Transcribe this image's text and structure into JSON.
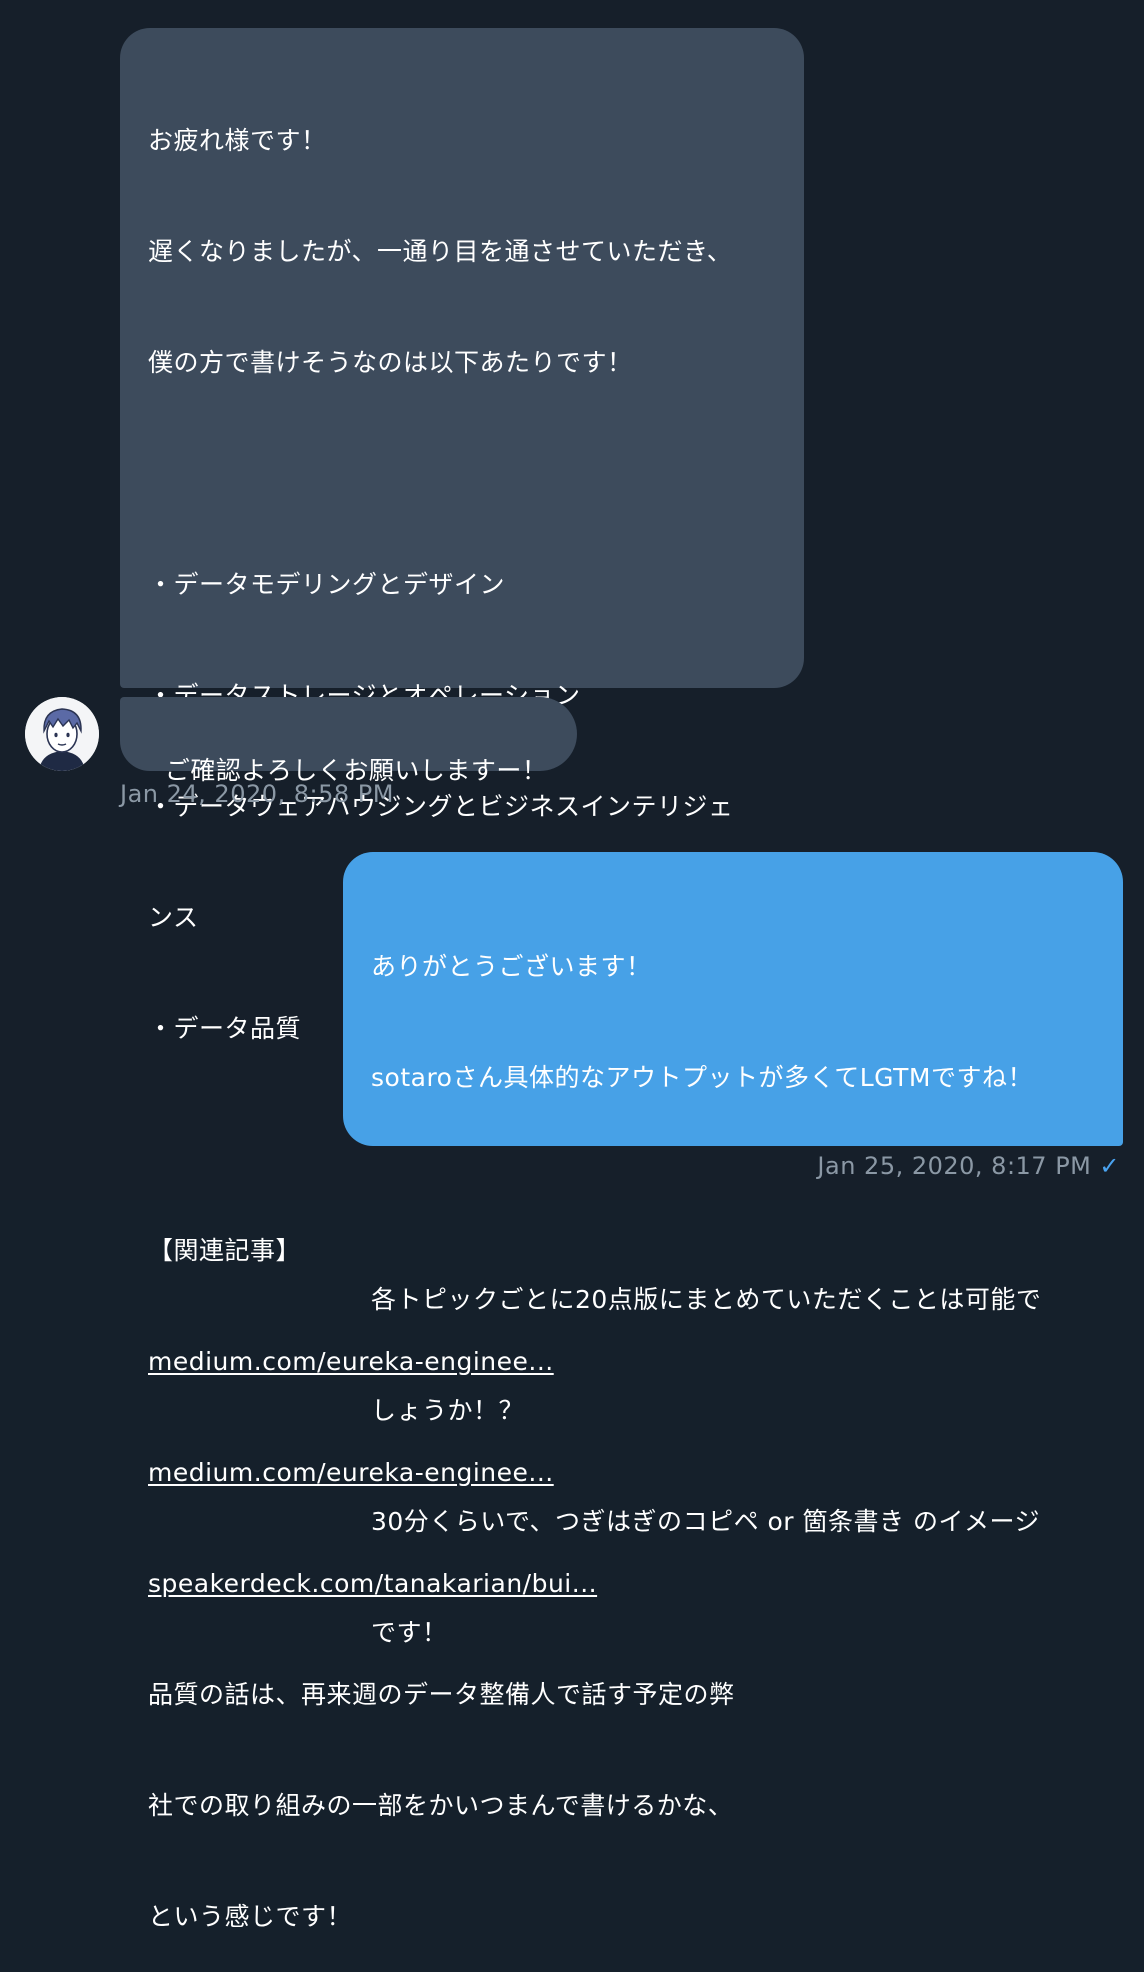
{
  "incoming_message_1": {
    "lines": [
      "お疲れ様です！",
      "遅くなりましたが、一通り目を通させていただき、",
      "僕の方で書けそうなのは以下あたりです！",
      "",
      "・データモデリングとデザイン",
      "・データストレージとオペレーション",
      "・データウェアハウジングとビジネスインテリジェ",
      "ンス",
      "・データ品質",
      "",
      "【関連記事】"
    ],
    "links": [
      "medium.com/eureka-enginee...",
      "medium.com/eureka-enginee...",
      "speakerdeck.com/tanakarian/bui..."
    ],
    "tail_lines": [
      "品質の話は、再来週のデータ整備人で話す予定の弊",
      "社での取り組みの一部をかいつまんで書けるかな、",
      "という感じです！"
    ]
  },
  "incoming_message_2": {
    "text": "ご確認よろしくお願いしますー！"
  },
  "incoming_timestamp": "Jan 24, 2020, 8:58 PM",
  "outgoing_message": {
    "lines": [
      "ありがとうございます！",
      "sotaroさん具体的なアウトプットが多くてLGTMですね！",
      "",
      "各トピックごとに20点版にまとめていただくことは可能で",
      "しょうか！？",
      "30分くらいで、つぎはぎのコピペ or 箇条書き のイメージ",
      "です！"
    ]
  },
  "outgoing_timestamp": "Jan 25, 2020, 8:17 PM",
  "read_status_icon": "checkmark-icon",
  "colors": {
    "background": "#161f2a",
    "incoming_bubble": "#3d4b5c",
    "outgoing_bubble": "#47a1e7",
    "timestamp": "#8b98a5",
    "check": "#4aa3f0"
  }
}
